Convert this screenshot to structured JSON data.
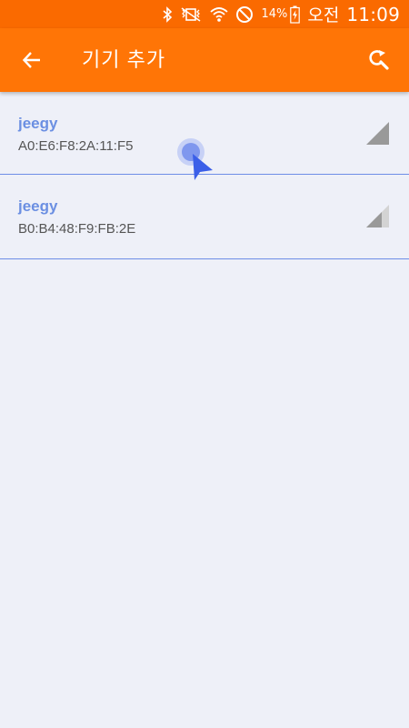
{
  "status_bar": {
    "battery_percent": "14%",
    "ampm": "오전",
    "time": "11:09",
    "icons": [
      "bluetooth-icon",
      "vibrate-mute-icon",
      "wifi-icon",
      "do-not-disturb-icon",
      "battery-charging-icon"
    ]
  },
  "app_bar": {
    "title": "기기 추가",
    "back_icon": "arrow-left-icon",
    "search_icon": "search-refresh-icon",
    "color": "#ff7506"
  },
  "devices": [
    {
      "name": "jeegy",
      "address": "A0:E6:F8:2A:11:F5",
      "signal_level": 1.0
    },
    {
      "name": "jeegy",
      "address": "B0:B4:48:F9:FB:2E",
      "signal_level": 0.5
    }
  ],
  "colors": {
    "status_bar": "#fa6a00",
    "accent_text": "#6b8fe2",
    "divider": "#6e8ee6",
    "background": "#eef0f8"
  }
}
